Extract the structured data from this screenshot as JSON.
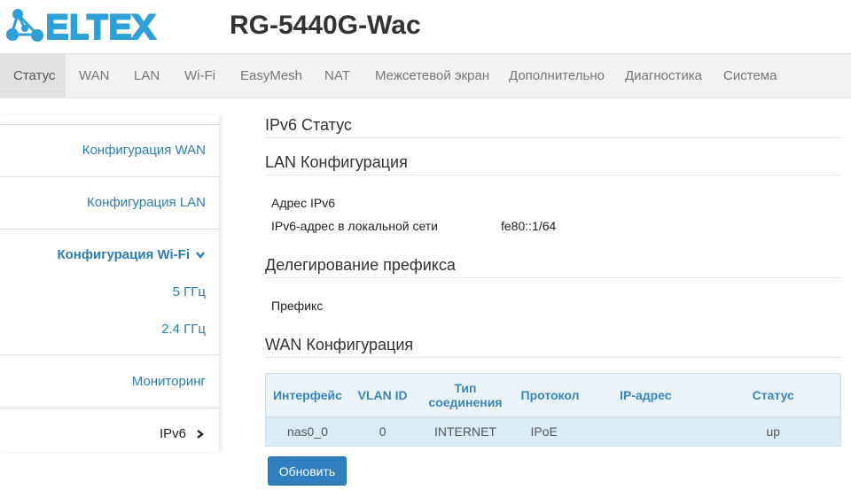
{
  "brand": {
    "logo_text": "ELTEX",
    "logo_color": "#2f9fd8"
  },
  "header": {
    "model": "RG-5440G-Wac"
  },
  "topnav": {
    "tabs": [
      {
        "label": "Статус",
        "active": true
      },
      {
        "label": "WAN"
      },
      {
        "label": "LAN"
      },
      {
        "label": "Wi-Fi"
      },
      {
        "label": "EasyMesh"
      },
      {
        "label": "NAT"
      },
      {
        "label": "Межсетевой экран"
      },
      {
        "label": "Дополнительно"
      },
      {
        "label": "Диагностика"
      },
      {
        "label": "Система"
      }
    ]
  },
  "sidebar": {
    "items": [
      {
        "label": "Конфигурация WAN"
      },
      {
        "label": "Конфигурация LAN"
      },
      {
        "label": "Конфигурация Wi-Fi",
        "icon": "chevron-down-icon",
        "expanded": true
      },
      {
        "label": "5 ГГц"
      },
      {
        "label": "2.4 ГГц"
      },
      {
        "label": "Мониторинг"
      },
      {
        "label": "IPv6",
        "icon": "chevron-right-icon",
        "active": true
      }
    ]
  },
  "main": {
    "page_title": "IPv6 Статус",
    "lan": {
      "title": "LAN Конфигурация",
      "rows": [
        {
          "label": "Адрес IPv6",
          "value": ""
        },
        {
          "label": "IPv6-адрес в локальной сети",
          "value": "fe80::1/64"
        }
      ]
    },
    "prefix": {
      "title": "Делегирование префикса",
      "rows": [
        {
          "label": "Префикс",
          "value": ""
        }
      ]
    },
    "wan": {
      "title": "WAN Конфигурация",
      "columns": [
        "Интерфейс",
        "VLAN ID",
        "Тип соединения",
        "Протокол",
        "IP-адрес",
        "Статус"
      ],
      "rows": [
        [
          "nas0_0",
          "0",
          "INTERNET",
          "IPoE",
          "",
          "up"
        ]
      ]
    },
    "refresh_label": "Обновить"
  },
  "colors": {
    "accent": "#2f7fc1",
    "link": "#2d7bb5",
    "table_header_bg": "#eaf3f9",
    "table_row_bg": "#d9ecf7"
  }
}
